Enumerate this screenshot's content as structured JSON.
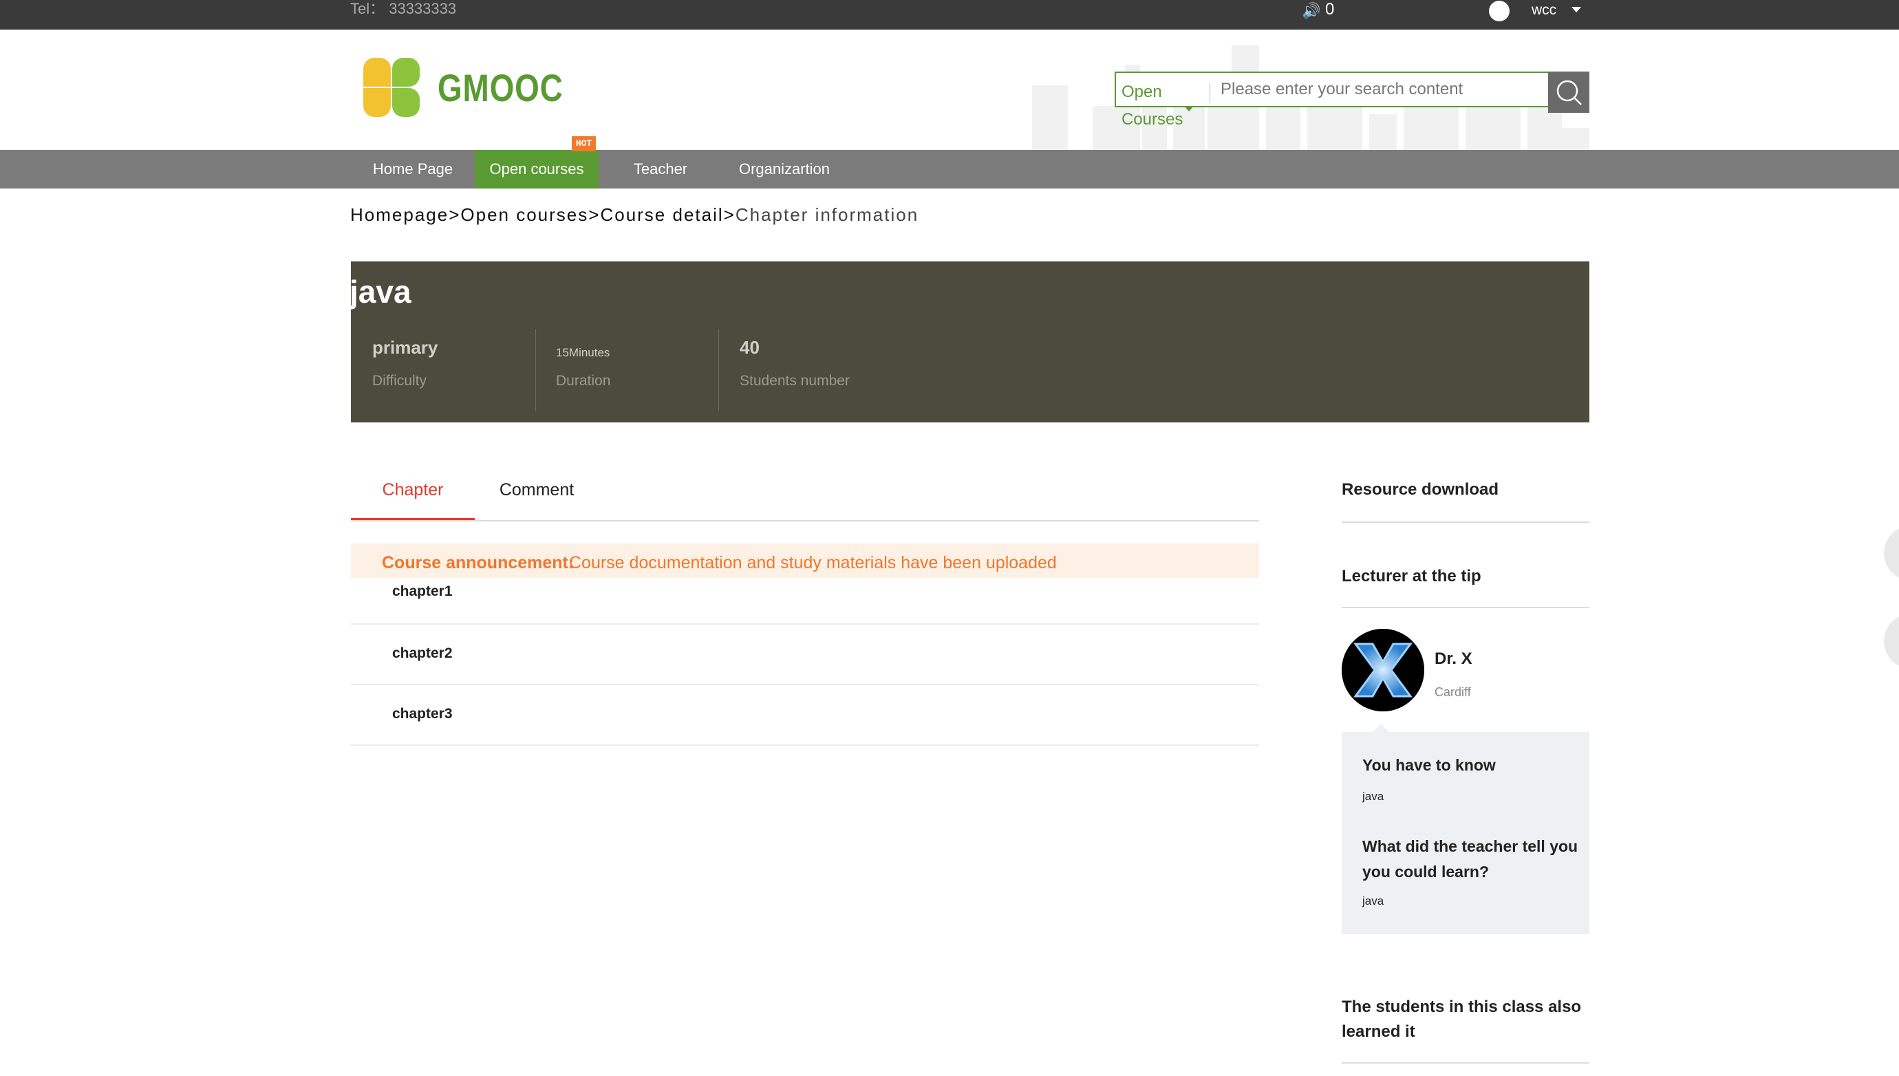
{
  "topbar": {
    "tel": "Tel： 33333333",
    "speaker_icon": "🔊",
    "message_count": "0",
    "username": "wcc"
  },
  "header": {
    "logo_text": "GMOOC",
    "search": {
      "scope": "Open Courses",
      "placeholder": "Please enter your search content"
    }
  },
  "nav": {
    "items": [
      {
        "label": "Home Page"
      },
      {
        "label": "Open courses",
        "active": true
      },
      {
        "label": "Teacher"
      },
      {
        "label": "Organizartion"
      }
    ],
    "hot_badge": "HOT"
  },
  "breadcrumb": {
    "home": "Homepage>",
    "open": "Open courses>",
    "detail": "Course detail>",
    "current": "Chapter information"
  },
  "course": {
    "title": "java",
    "stats": [
      {
        "value": "primary",
        "label": "Difficulty"
      },
      {
        "value": "15Minutes",
        "label": "Duration"
      },
      {
        "value": "40",
        "label": "Students number"
      }
    ]
  },
  "tabs": [
    {
      "label": "Chapter",
      "active": true
    },
    {
      "label": "Comment",
      "active": false
    }
  ],
  "announcement": {
    "label": "Course announcement:",
    "text": "Course documentation and study materials have been uploaded"
  },
  "chapters": [
    "chapter1",
    "chapter2",
    "chapter3"
  ],
  "sidebar": {
    "resource_title": "Resource download",
    "lecturer_title": "Lecturer at the tip",
    "lecturer": {
      "name": "Dr. X",
      "place": "Cardiff"
    },
    "know_title": "You have to know",
    "know_value": "java",
    "learn_title": "What did the teacher tell you you could learn?",
    "learn_value": "java",
    "also_learned_title": "The students in this class also learned it"
  },
  "colors": {
    "brand_green": "#5a9a32",
    "accent_red": "#e23a2a",
    "announcement_orange": "#f0762c",
    "banner": "#4d4b3d"
  }
}
